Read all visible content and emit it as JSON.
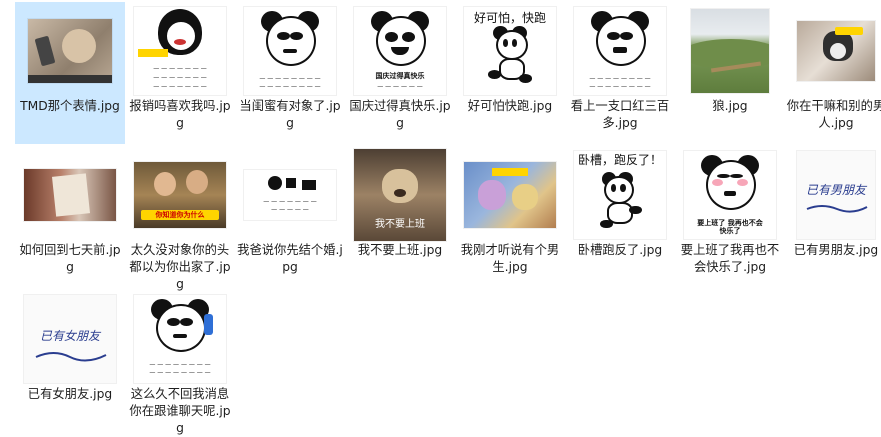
{
  "files": [
    {
      "name": "TMD那个表情.jpg",
      "selected": true,
      "icon": "monkey-phone-thumbnail"
    },
    {
      "name": "报销吗喜欢我吗.jpg",
      "icon": "meme-girl-thumbnail"
    },
    {
      "name": "当闺蜜有对象了.jpg",
      "icon": "panda-face-thumbnail"
    },
    {
      "name": "国庆过得真快乐.jpg",
      "icon": "panda-face-thumbnail",
      "caption": "国庆过得真快乐"
    },
    {
      "name": "好可怕快跑.jpg",
      "icon": "panda-running-thumbnail",
      "caption": "好可怕，快跑"
    },
    {
      "name": "看上一支口红三百多.jpg",
      "icon": "panda-face-thumbnail"
    },
    {
      "name": "狼.jpg",
      "icon": "landscape-photo-thumbnail"
    },
    {
      "name": "你在干嘛和别的男人.jpg",
      "icon": "dog-photo-thumbnail"
    },
    {
      "name": "如何回到七天前.jpg",
      "icon": "book-photo-thumbnail"
    },
    {
      "name": "太久没对象你的头都以为你出家了.jpg",
      "icon": "monk-photo-thumbnail",
      "caption": "你知道你为什么"
    },
    {
      "name": "我爸说你先结个婚.jpg",
      "icon": "meme-comic-thumbnail"
    },
    {
      "name": "我不要上班.jpg",
      "icon": "dog-photo-thumbnail",
      "caption": "我不要上班"
    },
    {
      "name": "我刚才听说有个男生.jpg",
      "icon": "cartoon-thumbnail"
    },
    {
      "name": "卧槽跑反了.jpg",
      "icon": "panda-running-thumbnail",
      "caption": "卧槽，跑反了！"
    },
    {
      "name": "要上班了我再也不会快乐了.jpg",
      "icon": "panda-face-thumbnail",
      "caption": "要上班了 我再也不会快乐了"
    },
    {
      "name": "已有男朋友.jpg",
      "icon": "handwriting-thumbnail",
      "caption": "已有男朋友"
    },
    {
      "name": "已有女朋友.jpg",
      "icon": "handwriting-thumbnail",
      "caption": "已有女朋友"
    },
    {
      "name": "这么久不回我消息你在跟谁聊天呢.jpg",
      "icon": "panda-phone-thumbnail"
    }
  ]
}
